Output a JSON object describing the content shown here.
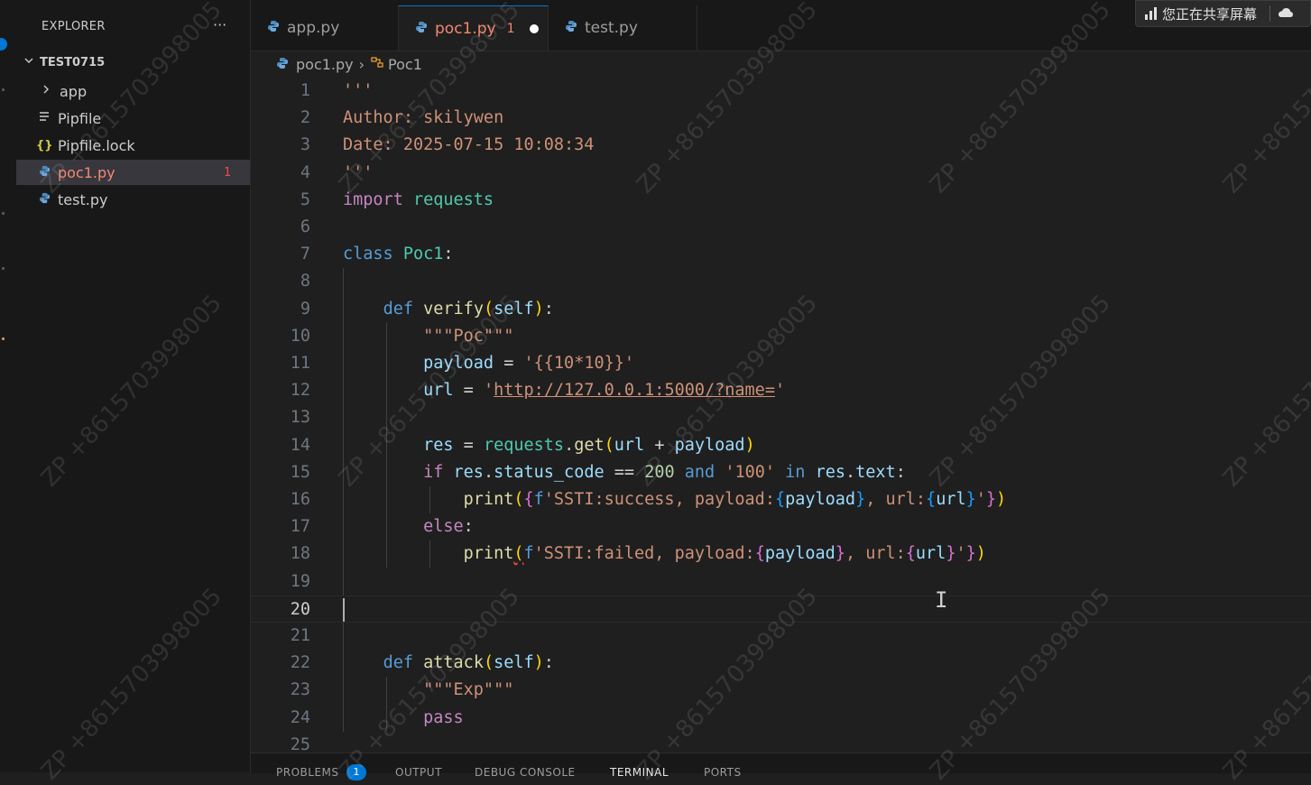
{
  "explorer": {
    "title": "EXPLORER",
    "more_label": "···",
    "project": "TEST0715",
    "items": [
      {
        "label": "app",
        "icon": "chevron-right-icon"
      },
      {
        "label": "Pipfile",
        "icon": "lines-icon"
      },
      {
        "label": "Pipfile.lock",
        "icon": "braces-icon"
      },
      {
        "label": "poc1.py",
        "icon": "python-icon",
        "badge": "1"
      },
      {
        "label": "test.py",
        "icon": "python-icon"
      }
    ]
  },
  "tabs": [
    {
      "label": "app.py"
    },
    {
      "label": "poc1.py",
      "badge": "1"
    },
    {
      "label": "test.py"
    }
  ],
  "share": {
    "label": "您正在共享屏幕"
  },
  "breadcrumb": {
    "file": "poc1.py",
    "symbol": "Poc1"
  },
  "line_numbers": [
    "1",
    "2",
    "3",
    "4",
    "5",
    "6",
    "7",
    "8",
    "9",
    "10",
    "11",
    "12",
    "13",
    "14",
    "15",
    "16",
    "17",
    "18",
    "19",
    "20",
    "21",
    "22",
    "23",
    "24",
    "25"
  ],
  "code": {
    "l1": "'''",
    "l2": "Author: skilywen",
    "l3": "Date: 2025-07-15 10:08:34",
    "l4": "'''",
    "l5_kw": "import",
    "l5_mod": "requests",
    "l7_kw": "class",
    "l7_name": "Poc1",
    "l9_name": "verify",
    "l10_doc": "\"\"\"Poc\"\"\"",
    "l11_val": "'{{10*10}}'",
    "l12_url": "http://127.0.0.1:5000/?name=",
    "l15_val1": "200",
    "l15_val2": "'100'",
    "l16_fstr1": "'SSTI:success, payload:",
    "l16_fstr2": ", url:",
    "l18_fstr1": "'SSTI:failed, payload:",
    "l22_name": "attack",
    "l23_doc": "\"\"\"Exp\"\"\"",
    "l24_kw": "pass"
  },
  "panel": {
    "problems": "PROBLEMS",
    "problems_count": "1",
    "output": "OUTPUT",
    "debug": "DEBUG CONSOLE",
    "terminal": "TERMINAL",
    "ports": "PORTS"
  },
  "watermark": "ZP +8615703998005",
  "colors": {
    "accent": "#0078d4",
    "error": "#f14c4c",
    "keyword": "#c586c0",
    "keyword_blue": "#569cd6",
    "class": "#4ec9b0",
    "function": "#dcdcaa",
    "variable": "#9cdcfe",
    "string": "#ce9178",
    "number": "#b5cea8"
  }
}
